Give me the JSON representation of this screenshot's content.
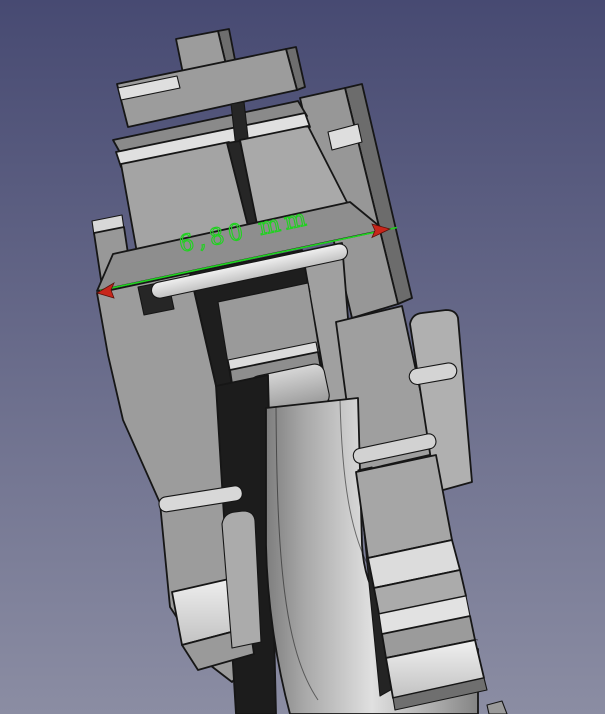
{
  "viewport": {
    "type": "3D CAD view",
    "background_top_color": "#474A72",
    "background_bottom_color": "#8B8DA3"
  },
  "model": {
    "name": "connector cross-section solid",
    "face_color": "#A2A2A2",
    "top_face_color": "#8A8A8A",
    "side_face_color": "#6C6C6C",
    "bevel_highlight_color": "#E0E0E0",
    "cavity_color": "#1E1E1E",
    "edge_color": "#161616"
  },
  "measurement": {
    "label": "6,80 mm",
    "value": "6,80",
    "unit": "mm",
    "line_color": "#1FD31F",
    "arrow_color": "#C8261B"
  }
}
